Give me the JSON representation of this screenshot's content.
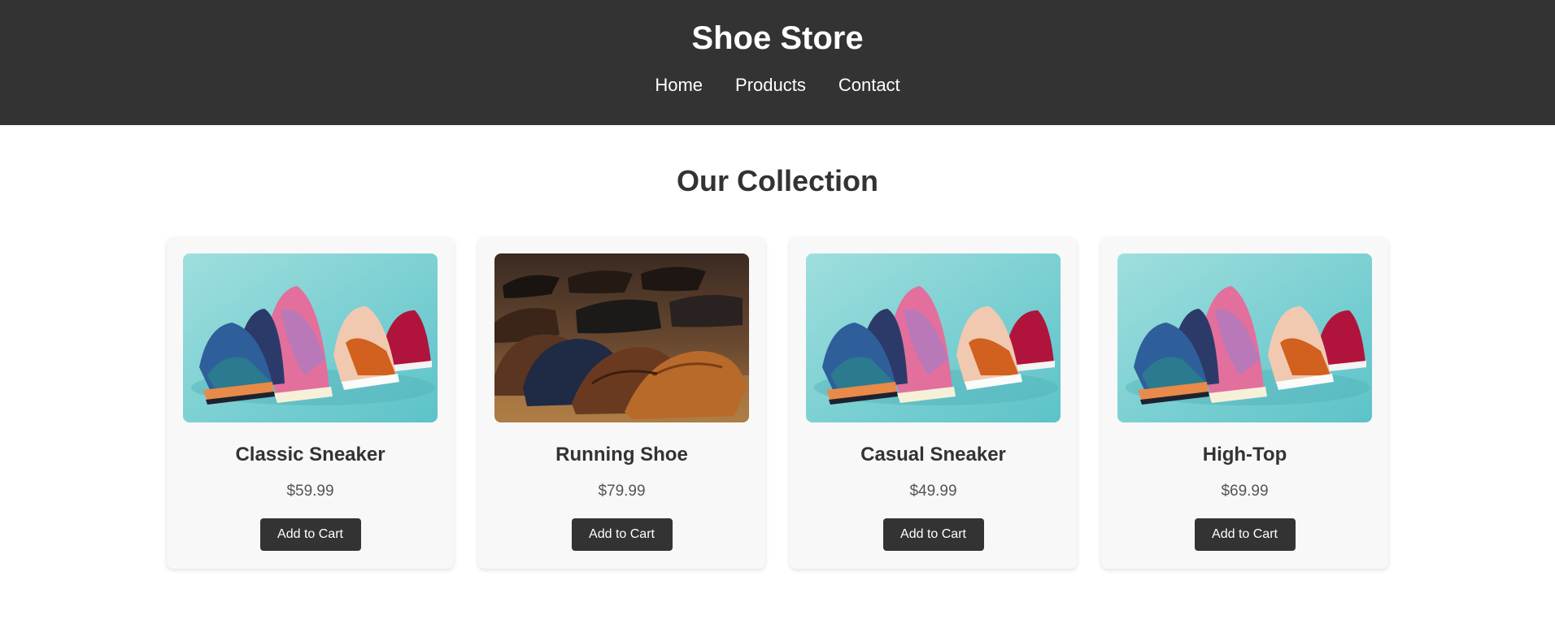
{
  "header": {
    "title": "Shoe Store",
    "nav": [
      {
        "label": "Home"
      },
      {
        "label": "Products"
      },
      {
        "label": "Contact"
      }
    ]
  },
  "main": {
    "section_title": "Our Collection",
    "products": [
      {
        "name": "Classic Sneaker",
        "price": "$59.99",
        "button": "Add to Cart",
        "image": "sneakers-photo"
      },
      {
        "name": "Running Shoe",
        "price": "$79.99",
        "button": "Add to Cart",
        "image": "leather-shoes-photo"
      },
      {
        "name": "Casual Sneaker",
        "price": "$49.99",
        "button": "Add to Cart",
        "image": "sneakers-photo"
      },
      {
        "name": "High-Top",
        "price": "$69.99",
        "button": "Add to Cart",
        "image": "sneakers-photo"
      }
    ]
  },
  "colors": {
    "header_bg": "#333333",
    "header_text": "#ffffff",
    "card_bg": "#f8f8f8",
    "button_bg": "#333333",
    "price_text": "#555555"
  }
}
